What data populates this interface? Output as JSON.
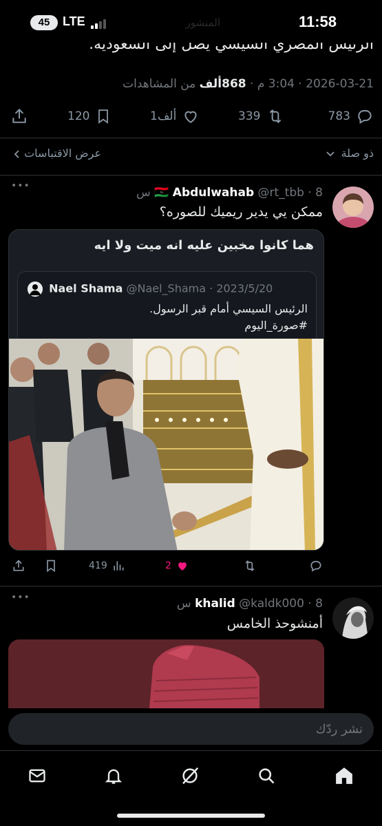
{
  "status_bar": {
    "battery": "45",
    "network": "LTE",
    "time": "11:58",
    "background_title": "المنشور"
  },
  "main_tweet": {
    "text_tail": "الرئيس المصري السيسي يصل إلى السعودية.",
    "date": "2026-03-21",
    "time": "3:04 م",
    "views_count": "868ألف",
    "views_label": "من المشاهدات",
    "separator": "·",
    "replies": "783",
    "reposts": "339",
    "likes": "1ألف",
    "bookmarks": "120"
  },
  "links": {
    "related": "ذو صلة",
    "view_quotes": "عرض الاقتباسات"
  },
  "reply1": {
    "flag": "🇱🇾",
    "name": "Abdulwahab",
    "handle": "@rt_tbb",
    "time": "8 س",
    "text": "ممكن يي يدير ريميك للصوره؟",
    "media_caption": "هما كانوا مخبين عليه انه ميت ولا ايه",
    "quoted": {
      "name": "Nael Shama",
      "handle": "@Nael_Shama",
      "date": "2023/5/20",
      "line1": "الرئيس السيسي أمام قبر الرسول.",
      "line2": "#صورة_اليوم"
    },
    "views": "419",
    "likes": "2",
    "colors": {
      "like": "#f91880"
    }
  },
  "reply2": {
    "name": "khalid",
    "handle": "@kaldk000",
    "time": "8 س",
    "text": "أمنشوحذ الخامس"
  },
  "composer": {
    "placeholder": "نشر ردّك"
  },
  "nav": {
    "items": [
      "home-icon",
      "search-icon",
      "grok-icon",
      "notifications-icon",
      "messages-icon"
    ]
  },
  "colors": {
    "background": "#000000",
    "text": "#e7e9ea",
    "muted": "#71767b",
    "like_accent": "#f91880"
  }
}
